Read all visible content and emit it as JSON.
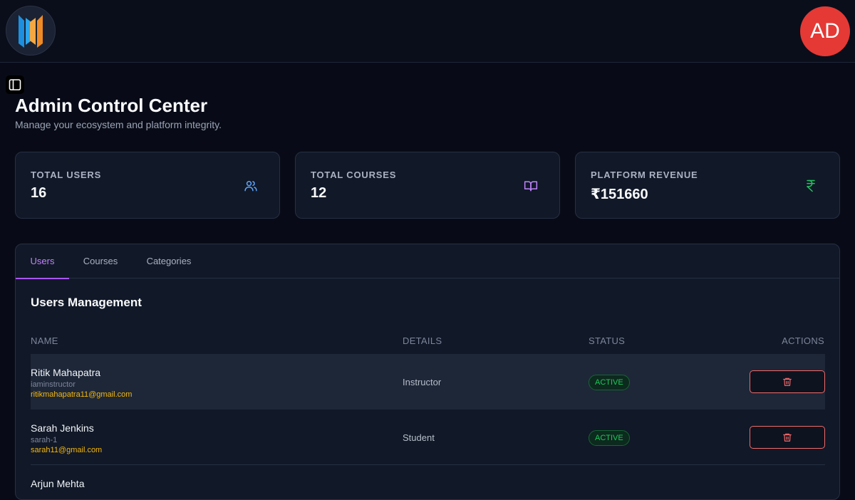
{
  "header": {
    "logo_icon": "brand-logo-icon",
    "avatar_initials": "AD",
    "avatar_color": "#e53935"
  },
  "sidebar_toggle_icon": "sidebar-toggle-icon",
  "page": {
    "title": "Admin Control Center",
    "subtitle": "Manage your ecosystem and platform integrity."
  },
  "stats": [
    {
      "label": "TOTAL USERS",
      "value": "16",
      "icon": "users-icon",
      "icon_color": "#60a5fa"
    },
    {
      "label": "TOTAL COURSES",
      "value": "12",
      "icon": "book-open-icon",
      "icon_color": "#c084fc"
    },
    {
      "label": "PLATFORM REVENUE",
      "value": "₹151660",
      "icon": "rupee-icon",
      "icon_color": "#22c55e"
    }
  ],
  "tabs": [
    {
      "label": "Users",
      "active": true
    },
    {
      "label": "Courses",
      "active": false
    },
    {
      "label": "Categories",
      "active": false
    }
  ],
  "users_section": {
    "title": "Users Management",
    "columns": {
      "name": "NAME",
      "details": "DETAILS",
      "status": "STATUS",
      "actions": "ACTIONS"
    },
    "rows": [
      {
        "name": "Ritik Mahapatra",
        "username": "iaminstructor",
        "email": "ritikmahapatra11@gmail.com",
        "role": "Instructor",
        "status": "ACTIVE",
        "action_icon": "trash-icon"
      },
      {
        "name": "Sarah Jenkins",
        "username": "sarah-1",
        "email": "sarah11@gmail.com",
        "role": "Student",
        "status": "ACTIVE",
        "action_icon": "trash-icon"
      },
      {
        "name": "Arjun Mehta"
      }
    ]
  },
  "colors": {
    "accent": "#a855f7",
    "active_status": "#22c55e",
    "email": "#f5b70a",
    "delete": "#f06a6a"
  }
}
